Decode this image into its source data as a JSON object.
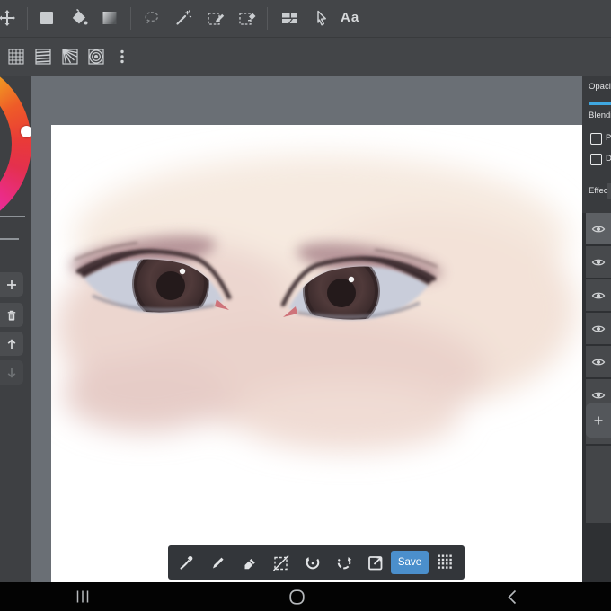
{
  "toolbar_top": {
    "tools": [
      "move",
      "shape-rect",
      "paint-bucket",
      "gradient",
      "lasso",
      "magic-wand",
      "select-pen",
      "select-eraser",
      "split-canvas",
      "cursor",
      "text"
    ],
    "text_tool_label": "Aa"
  },
  "toolbar_second": {
    "tools": [
      "material-grid",
      "screentone-lines",
      "screentone-rays",
      "screentone-circles",
      "overflow-menu"
    ]
  },
  "left_sidebar": {
    "color_wheel": {
      "selected_color": "#ef4430"
    },
    "buttons": [
      "add",
      "delete",
      "move-up",
      "move-down"
    ],
    "move_down_enabled": false
  },
  "canvas": {
    "content": "digital painting of a pair of brown eyes on pale skin"
  },
  "right_panel": {
    "opacity_label": "Opacity",
    "blending_label": "Blending",
    "checkbox1_label": "P",
    "checkbox2_label": "D",
    "effect_label": "Effect",
    "layers": {
      "visible_rows": 7,
      "selected_index": 0,
      "row_icon": "eye"
    },
    "add_button_icon": "plus"
  },
  "floating_toolbar": {
    "tools": [
      "eyedropper",
      "brush",
      "eraser",
      "deselect",
      "undo",
      "redo",
      "export"
    ],
    "save_label": "Save",
    "handle_icon": "drag-grid"
  },
  "nav_bar": {
    "icons": [
      "recent-apps",
      "home",
      "back"
    ]
  },
  "colors": {
    "accent_blue": "#4b8fcc",
    "slider_blue": "#3fa7e0",
    "workspace_gray": "#6a6f75",
    "toolbar_gray": "#434548"
  }
}
